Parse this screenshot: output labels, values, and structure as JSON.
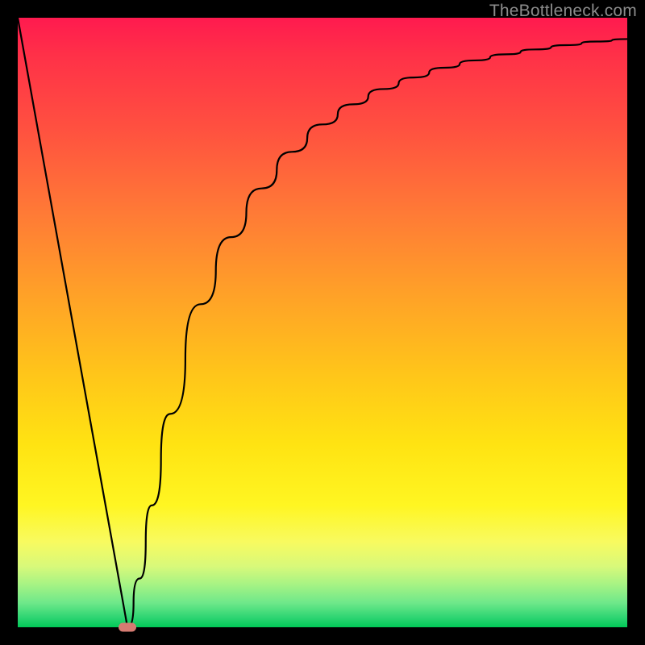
{
  "watermark": "TheBottleneck.com",
  "chart_data": {
    "type": "line",
    "title": "",
    "xlabel": "",
    "ylabel": "",
    "xlim": [
      0,
      100
    ],
    "ylim": [
      0,
      100
    ],
    "grid": false,
    "series": [
      {
        "name": "curve",
        "x": [
          0,
          5,
          10,
          15,
          17.5,
          18,
          20,
          22,
          25,
          30,
          35,
          40,
          45,
          50,
          55,
          60,
          65,
          70,
          75,
          80,
          85,
          90,
          95,
          100
        ],
        "values": [
          100,
          72.2,
          44.4,
          16.7,
          2.8,
          0,
          8,
          20,
          35,
          53,
          64,
          72,
          78,
          82.5,
          85.8,
          88.3,
          90.2,
          91.8,
          93,
          94,
          94.8,
          95.5,
          96.1,
          96.5
        ]
      }
    ],
    "marker": {
      "x": 18,
      "y": 0,
      "color": "#d67b72"
    },
    "background_gradient": {
      "stops": [
        {
          "pos": 0,
          "color": "#ff1a4f"
        },
        {
          "pos": 0.5,
          "color": "#ffc41a"
        },
        {
          "pos": 0.85,
          "color": "#fff96a"
        },
        {
          "pos": 1.0,
          "color": "#00c957"
        }
      ]
    }
  }
}
